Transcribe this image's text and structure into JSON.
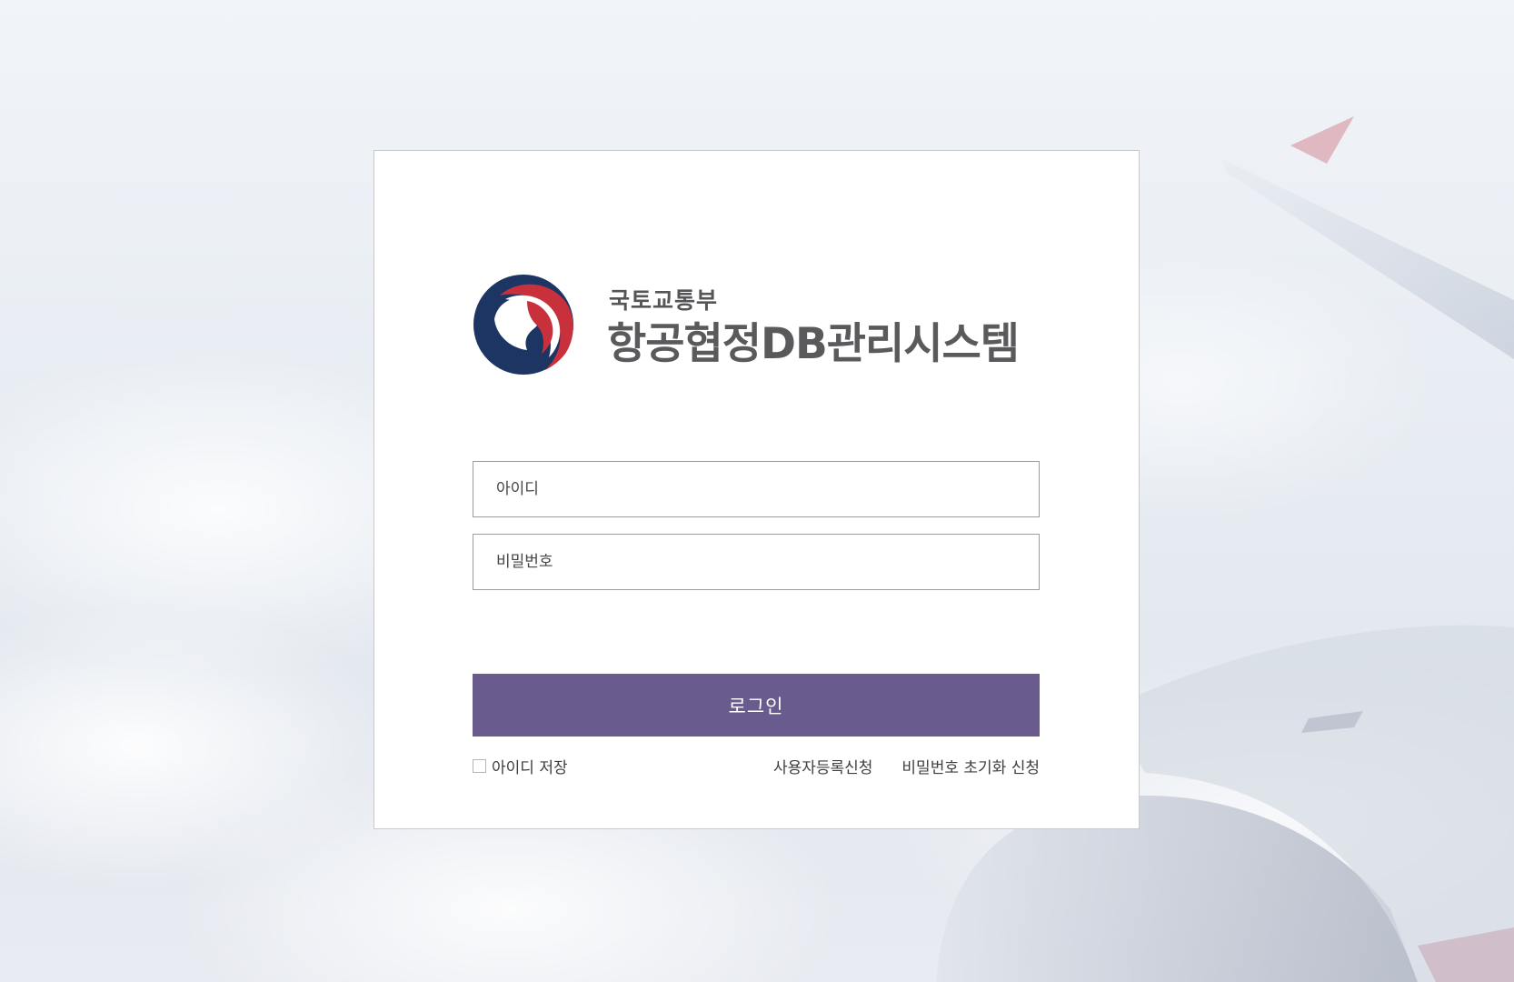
{
  "header": {
    "ministry_name": "국토교통부",
    "system_title": "항공협정DB관리시스템"
  },
  "login_form": {
    "id_placeholder": "아이디",
    "password_placeholder": "비밀번호",
    "login_button_label": "로그인",
    "remember_id_label": "아이디 저장",
    "remember_id_checked": false,
    "register_link_label": "사용자등록신청",
    "password_reset_link_label": "비밀번호 초기화 신청"
  },
  "colors": {
    "login_button": "#6a5b8f",
    "emblem_red": "#c8303c",
    "emblem_navy": "#1d3563",
    "title_text": "#5a5a5d"
  }
}
